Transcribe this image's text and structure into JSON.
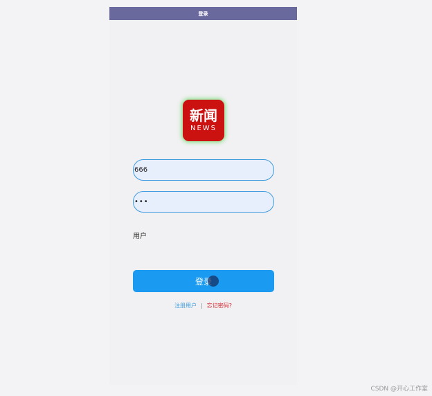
{
  "titlebar": {
    "title": "登录"
  },
  "logo": {
    "cn_text": "新闻",
    "en_text": "NEWS"
  },
  "form": {
    "username_value": "666",
    "password_value": "•••",
    "user_label": "用户"
  },
  "buttons": {
    "login_label": "登录"
  },
  "links": {
    "register_label": "注册用户",
    "separator": "|",
    "forgot_label": "忘记密码?"
  },
  "watermark": {
    "text": "CSDN @开心工作室"
  },
  "colors": {
    "titlebar": "#6a699e",
    "primary": "#1a9af0",
    "input_border": "#3e9be0",
    "input_bg": "#e8effc",
    "logo_red": "#cc1111",
    "forgot_red": "#d2232a"
  }
}
